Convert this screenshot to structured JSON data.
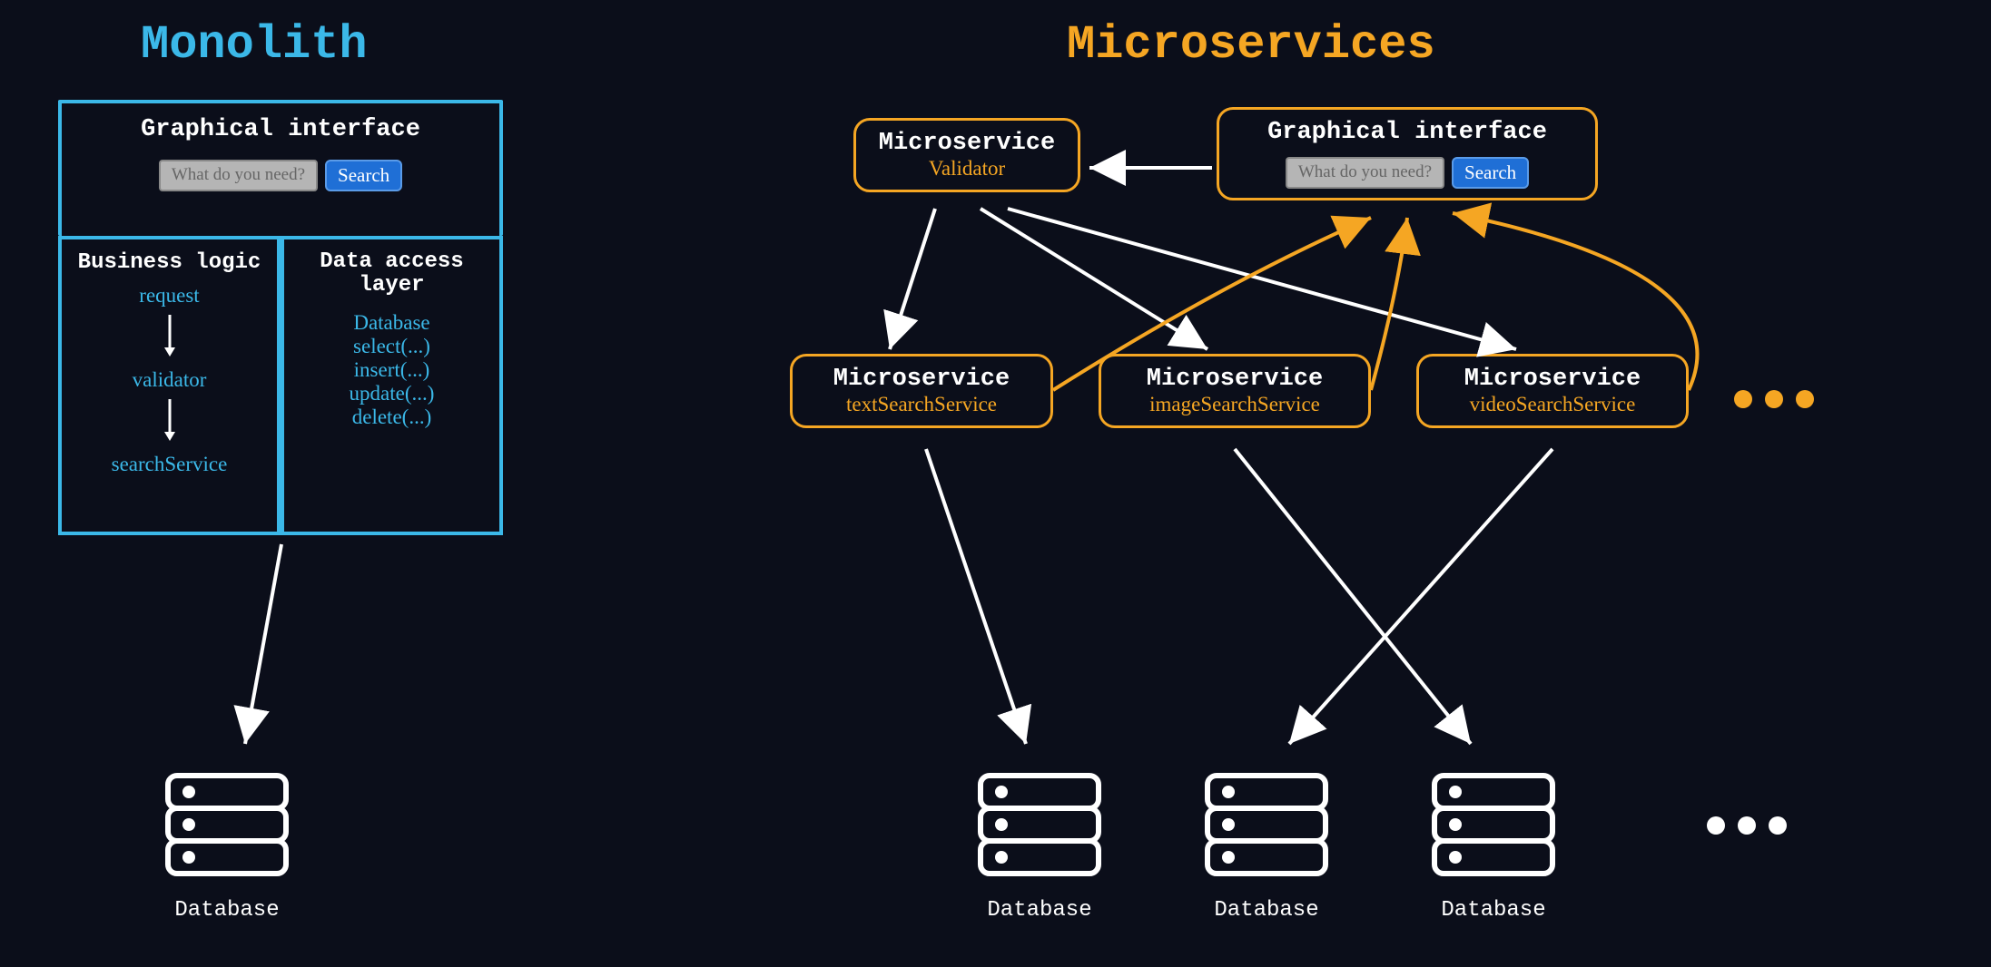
{
  "monolith": {
    "title": "Monolith",
    "gui": {
      "heading": "Graphical interface",
      "placeholder": "What do you need?",
      "button": "Search"
    },
    "business": {
      "heading": "Business logic",
      "steps": [
        "request",
        "validator",
        "searchService"
      ]
    },
    "dal": {
      "heading": "Data access layer",
      "lines": [
        "Database",
        "select(...)",
        "insert(...)",
        "update(...)",
        "delete(...)"
      ]
    },
    "db_label": "Database"
  },
  "microservices": {
    "title": "Microservices",
    "gui": {
      "heading": "Graphical interface",
      "placeholder": "What do you need?",
      "button": "Search"
    },
    "validator": {
      "heading": "Microservice",
      "name": "Validator"
    },
    "services": [
      {
        "heading": "Microservice",
        "name": "textSearchService"
      },
      {
        "heading": "Microservice",
        "name": "imageSearchService"
      },
      {
        "heading": "Microservice",
        "name": "videoSearchService"
      }
    ],
    "db_label": "Database"
  }
}
